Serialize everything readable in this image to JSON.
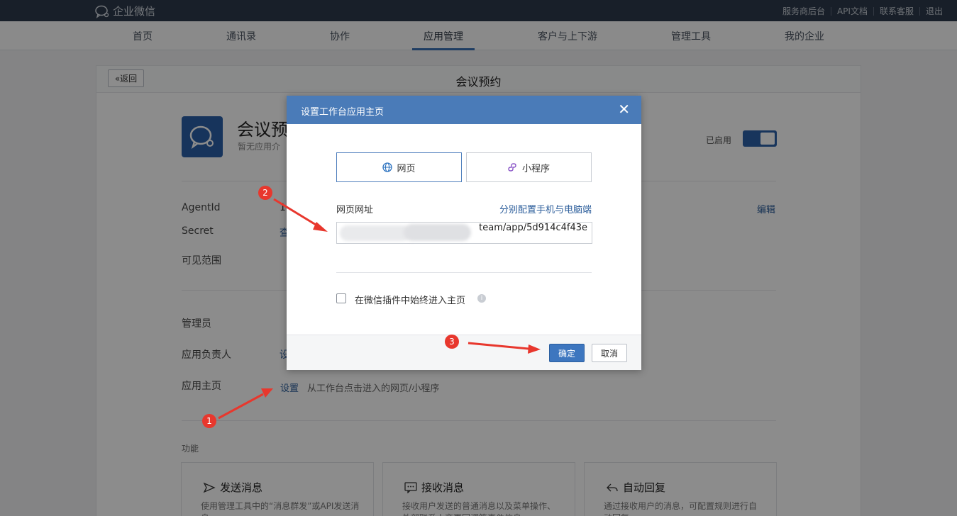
{
  "topbar": {
    "brand": "企业微信",
    "links": [
      "服务商后台",
      "API文档",
      "联系客服",
      "退出"
    ]
  },
  "nav": {
    "items": [
      "首页",
      "通讯录",
      "协作",
      "应用管理",
      "客户与上下游",
      "管理工具",
      "我的企业"
    ],
    "active": "应用管理"
  },
  "page": {
    "back_label": "返回",
    "title": "会议预约",
    "app_name": "会议预",
    "app_desc": "暂无应用介",
    "enabled_label": "已启用",
    "rows": {
      "agentid_label": "AgentId",
      "agentid_value": "1",
      "secret_label": "Secret",
      "secret_value": "查",
      "scope_label": "可见范围",
      "admin_label": "管理员",
      "owner_label": "应用负责人",
      "owner_value": "设",
      "homepage_label": "应用主页"
    },
    "edit_link": "编辑",
    "homepage_set_link": "设置",
    "homepage_hint": "从工作台点击进入的网页/小程序",
    "features_title": "功能",
    "features": [
      {
        "title": "发送消息",
        "desc": "使用管理工具中的“消息群发”或API发送消息"
      },
      {
        "title": "接收消息",
        "desc": "接收用户发送的普通消息以及菜单操作、外部联系人变更回调等事件信息"
      },
      {
        "title": "自动回复",
        "desc": "通过接收用户的消息，可配置规则进行自动回复"
      }
    ]
  },
  "dialog": {
    "title": "设置工作台应用主页",
    "close": "✕",
    "tab_web": "网页",
    "tab_mini": "小程序",
    "url_label": "网页网址",
    "split_link": "分别配置手机与电脑端",
    "url_value": "team/app/5d914c4f43e",
    "checkbox_label": "在微信插件中始终进入主页",
    "ok": "确定",
    "cancel": "取消"
  },
  "markers": [
    "1",
    "2",
    "3"
  ],
  "colors": {
    "topbar": "#2c3a4c",
    "accent": "#3d76bf",
    "dialog_header": "#4a7bb8",
    "marker": "#e8372d"
  }
}
